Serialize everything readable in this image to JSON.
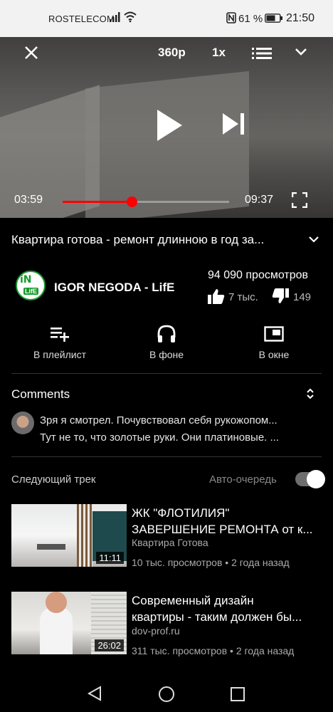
{
  "status_bar": {
    "carrier": "ROSTELECOM",
    "battery_pct": "61 %",
    "time": "21:50"
  },
  "player": {
    "quality": "360p",
    "speed": "1x",
    "current_time": "03:59",
    "duration": "09:37",
    "progress_fraction": 0.415,
    "progress_color": "#ff0000"
  },
  "video": {
    "title": "Квартира готова - ремонт длинною в год за...",
    "channel": "IGOR NEGODA - LifE",
    "channel_logo_text": "iN LifE",
    "views": "94 090 просмотров",
    "likes": "7 тыс.",
    "dislikes": "149"
  },
  "actions": {
    "playlist": "В плейлист",
    "background": "В фоне",
    "popup": "В окне"
  },
  "comments": {
    "title": "Comments",
    "line1": "Зря я смотрел. Почувствовал себя рукожопом...",
    "line2": "Тут не то, что золотые руки. Они платиновые. ..."
  },
  "up_next": {
    "label": "Следующий трек",
    "autoplay_label": "Авто-очередь",
    "autoplay_on": true,
    "items": [
      {
        "title_line1": "ЖК \"ФЛОТИЛИЯ\"",
        "title_line2": "ЗАВЕРШЕНИЕ РЕМОНТА от к...",
        "channel": "Квартира Готова",
        "meta": "10 тыс. просмотров • 2 года назад",
        "duration": "11:11"
      },
      {
        "title_line1": "Современный дизайн",
        "title_line2": "квартиры - таким должен бы...",
        "channel": "dov-prof.ru",
        "meta": "311 тыс. просмотров • 2 года назад",
        "duration": "26:02"
      }
    ]
  }
}
